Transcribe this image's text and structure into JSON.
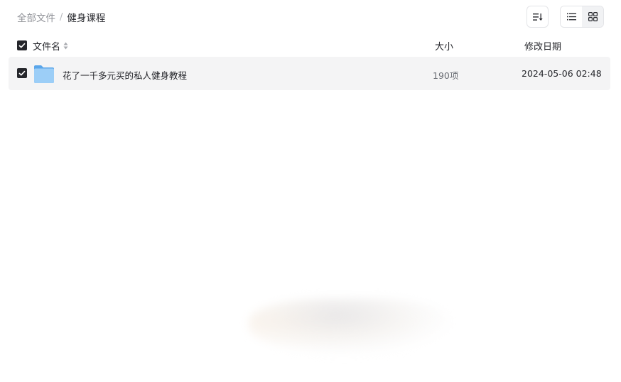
{
  "breadcrumb": {
    "root": "全部文件",
    "separator": "/",
    "current": "健身课程"
  },
  "toolbar": {
    "sort_icon": "sort-icon",
    "list_view_icon": "list-view-icon",
    "grid_view_icon": "grid-view-icon"
  },
  "table": {
    "columns": {
      "name": "文件名",
      "size": "大小",
      "date": "修改日期"
    },
    "rows": [
      {
        "name": "花了一千多元买的私人健身教程",
        "size": "190项",
        "date": "2024-05-06 02:48",
        "icon": "folder-icon",
        "checked": true
      }
    ]
  },
  "colors": {
    "text": "#25262b",
    "muted": "#8f9197",
    "row_bg": "#f4f4f5",
    "folder": "#7cbcf2"
  }
}
